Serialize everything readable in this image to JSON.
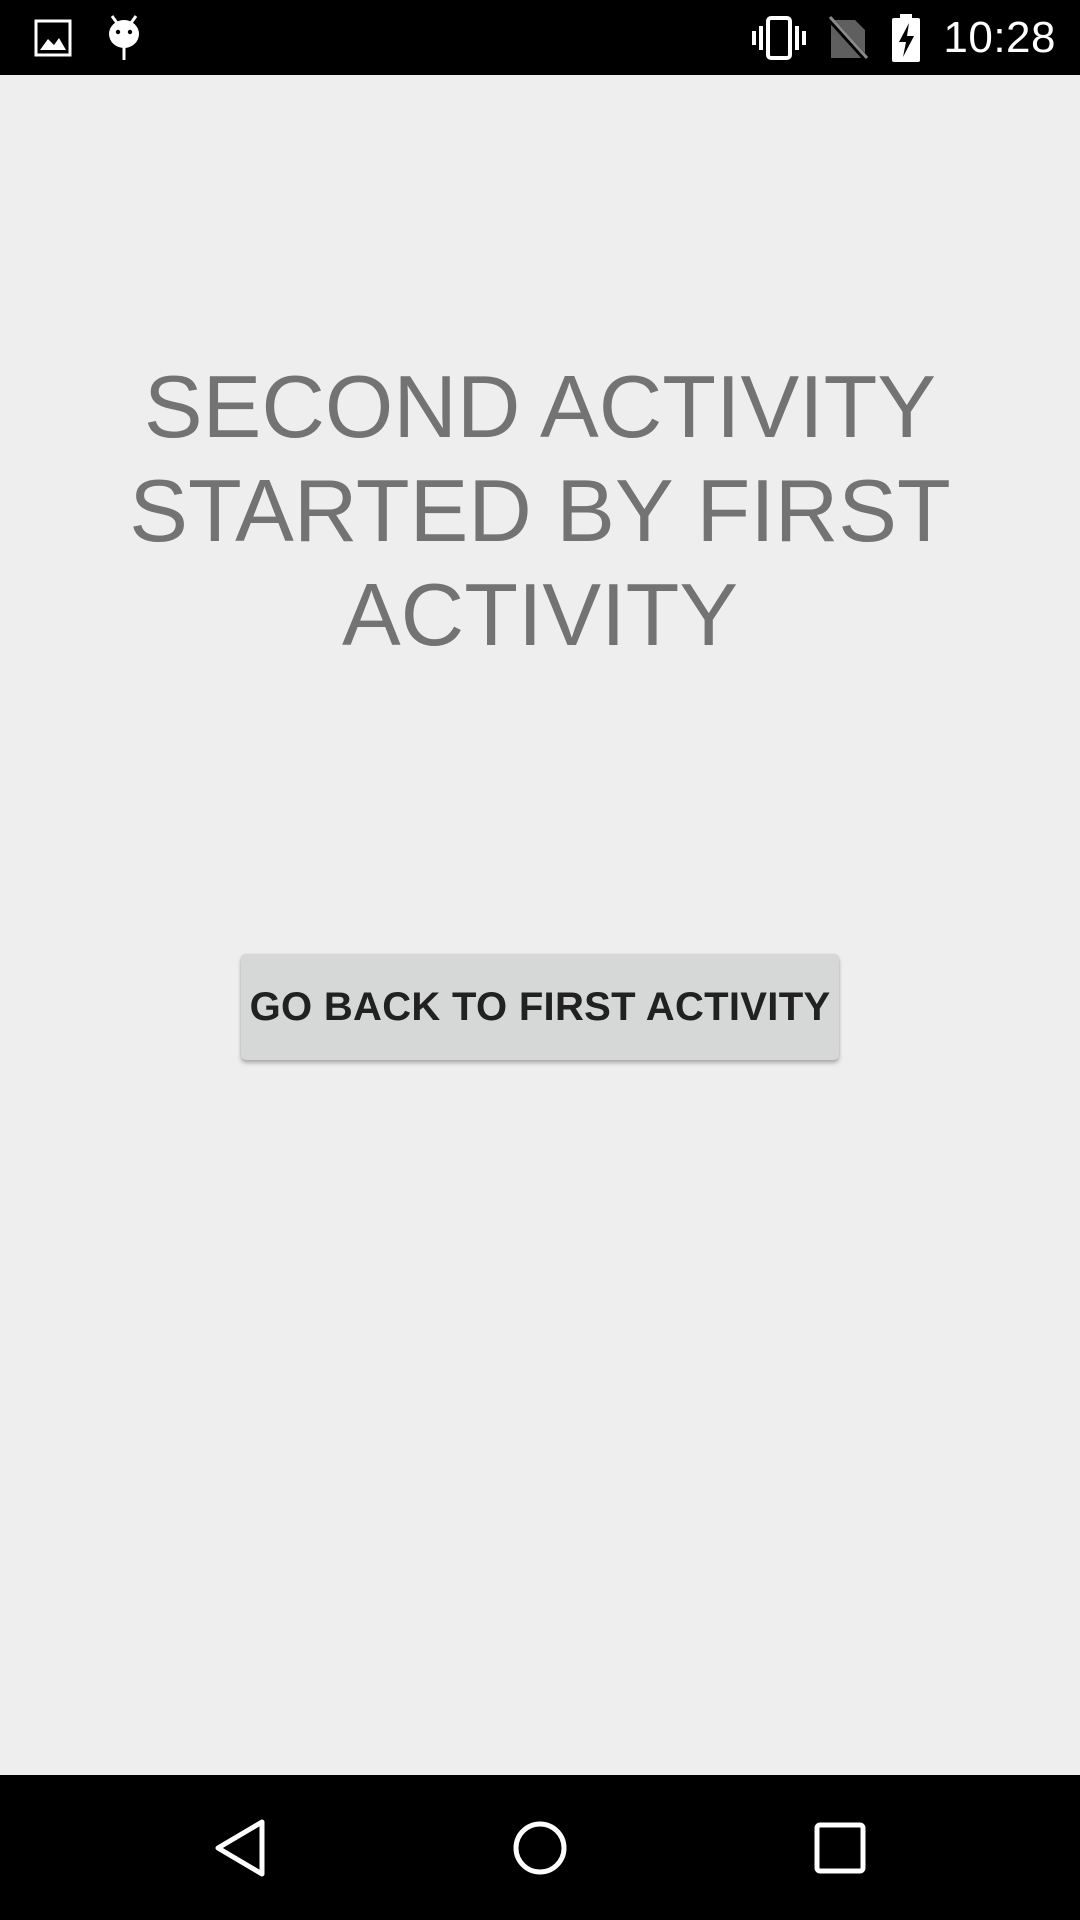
{
  "status_bar": {
    "time": "10:28",
    "left_icons": [
      "image-notification-icon",
      "android-debug-icon"
    ],
    "right_icons": [
      "vibrate-icon",
      "no-sim-icon",
      "battery-charging-icon"
    ]
  },
  "main": {
    "headline": "SECOND ACTIVITY STARTED BY FIRST ACTIVITY",
    "button_label": "GO BACK TO FIRST ACTIVITY"
  },
  "nav_bar": {
    "buttons": [
      "back-icon",
      "home-icon",
      "recents-icon"
    ]
  },
  "colors": {
    "background": "#eeeeee",
    "bars": "#000000",
    "headline_text": "#737373",
    "button_bg": "#d6d7d7",
    "button_text": "#212121"
  }
}
